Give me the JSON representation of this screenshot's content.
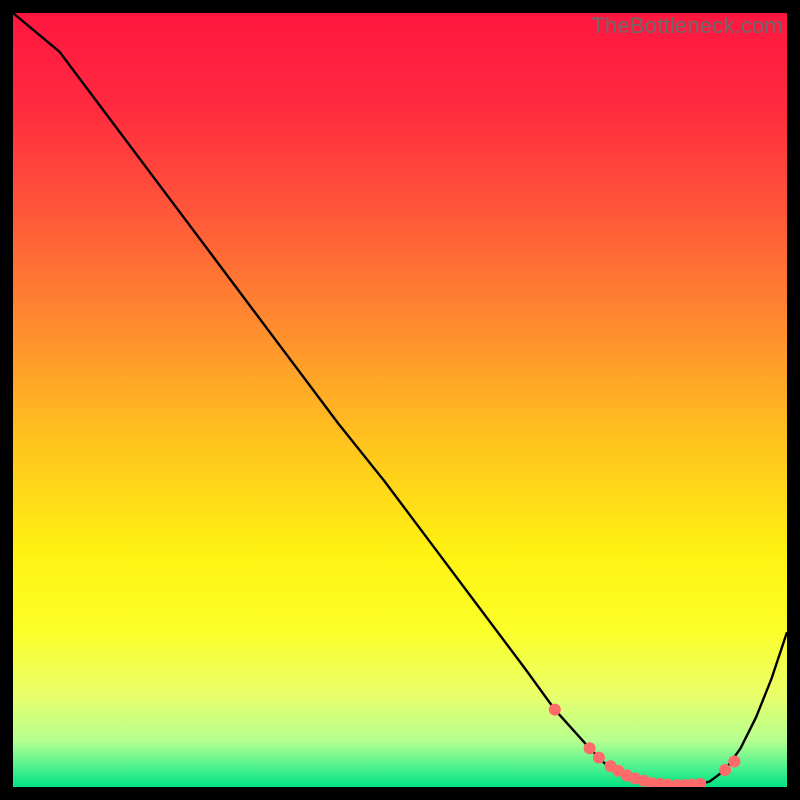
{
  "watermark": "TheBottleneck.com",
  "chart_data": {
    "type": "line",
    "title": "",
    "xlabel": "",
    "ylabel": "",
    "xlim": [
      0,
      100
    ],
    "ylim": [
      0,
      100
    ],
    "grid": false,
    "legend": false,
    "background_gradient": {
      "stops": [
        {
          "pos": 0.0,
          "color": "#ff163f"
        },
        {
          "pos": 0.12,
          "color": "#ff2a3f"
        },
        {
          "pos": 0.25,
          "color": "#ff543a"
        },
        {
          "pos": 0.4,
          "color": "#ff8a2f"
        },
        {
          "pos": 0.55,
          "color": "#ffc21e"
        },
        {
          "pos": 0.7,
          "color": "#fff312"
        },
        {
          "pos": 0.8,
          "color": "#fbff2a"
        },
        {
          "pos": 0.88,
          "color": "#e9ff6a"
        },
        {
          "pos": 0.94,
          "color": "#b6ff8f"
        },
        {
          "pos": 0.975,
          "color": "#4cf28f"
        },
        {
          "pos": 1.0,
          "color": "#00e083"
        }
      ]
    },
    "series": [
      {
        "name": "curve",
        "stroke": "#000000",
        "x": [
          0,
          6,
          12,
          18,
          24,
          30,
          36,
          42,
          48,
          54,
          60,
          66,
          70,
          74.5,
          77,
          79,
          81,
          83,
          85,
          87,
          88.5,
          90,
          92,
          94,
          96,
          98,
          100
        ],
        "values": [
          100,
          95,
          87,
          79,
          71,
          63,
          55,
          47,
          39.5,
          31.5,
          23.5,
          15.5,
          10,
          5,
          2.5,
          1.3,
          0.7,
          0.3,
          0.2,
          0.2,
          0.3,
          0.7,
          2.2,
          5,
          9,
          14,
          20
        ]
      }
    ],
    "markers": {
      "name": "marker-dots",
      "color": "#ff6b6b",
      "radius": 6,
      "x": [
        70,
        74.5,
        75.7,
        77.2,
        78.2,
        79.3,
        80.4,
        81.5,
        82.5,
        83.6,
        84.6,
        85.8,
        86.8,
        87.7,
        88.8,
        92,
        93.2
      ],
      "values": [
        10,
        5,
        3.8,
        2.7,
        2.1,
        1.5,
        1.1,
        0.8,
        0.5,
        0.4,
        0.3,
        0.25,
        0.25,
        0.3,
        0.4,
        2.2,
        3.3
      ]
    }
  }
}
